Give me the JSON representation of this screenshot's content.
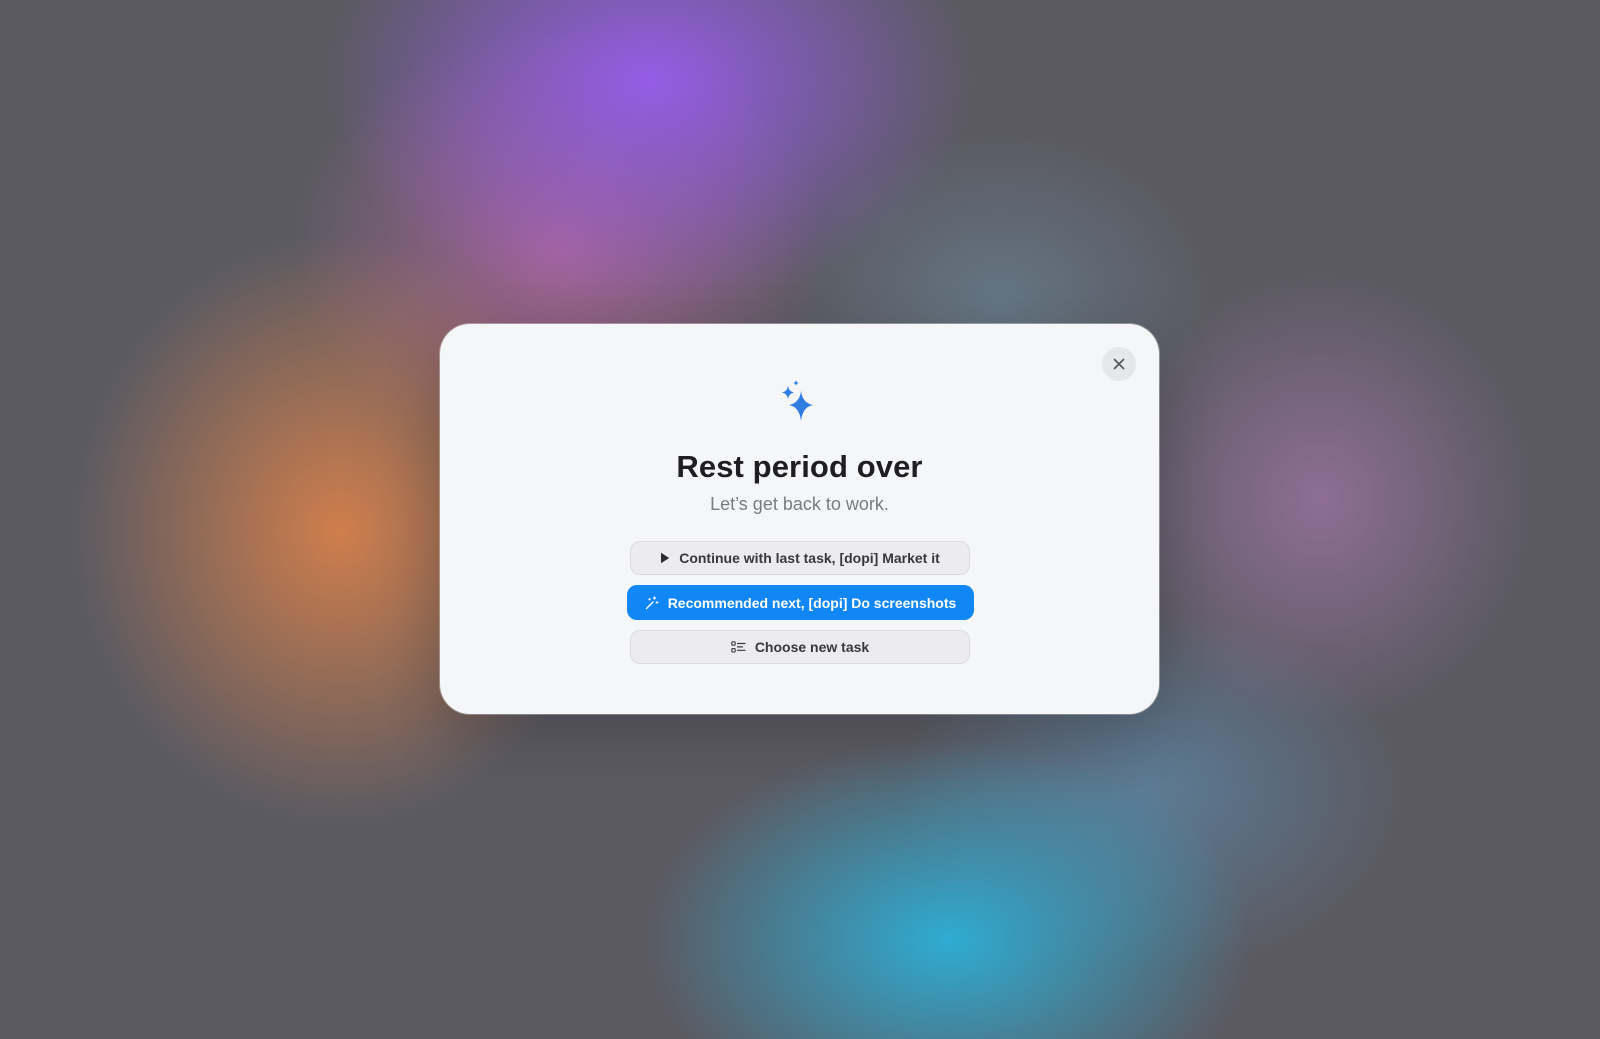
{
  "dialog": {
    "title": "Rest period over",
    "subtitle": "Let’s get back to work.",
    "close_icon": "close-icon",
    "header_icon": "sparkles-icon",
    "buttons": {
      "continue": {
        "label": "Continue with last task, [dopi] Market it",
        "icon": "play-icon"
      },
      "recommended": {
        "label": "Recommended next, [dopi] Do screenshots",
        "icon": "magic-wand-icon"
      },
      "choose": {
        "label": "Choose new task",
        "icon": "checklist-icon"
      }
    }
  },
  "colors": {
    "accent": "#1187F5",
    "sparkle": "#2F7DE1",
    "dialog_background": "#F5F6F7"
  }
}
